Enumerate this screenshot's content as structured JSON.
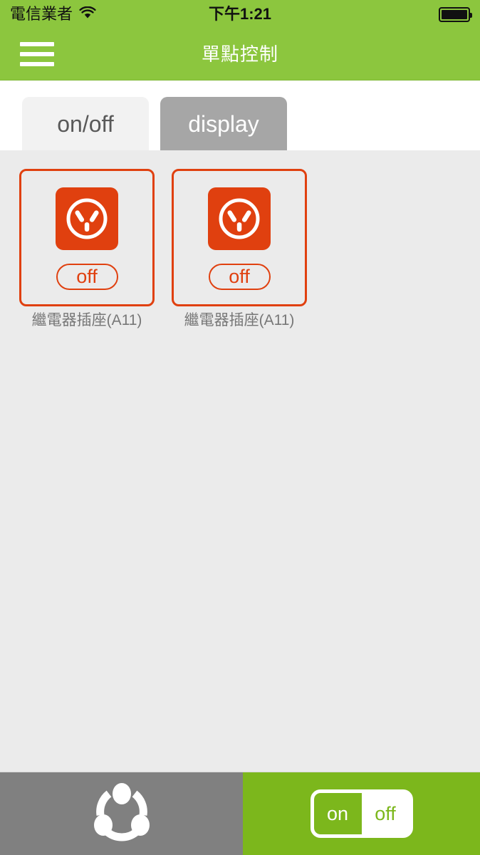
{
  "status_bar": {
    "carrier": "電信業者",
    "wifi_icon": "wifi-icon",
    "time": "下午1:21",
    "battery_icon": "battery-full-icon"
  },
  "nav_bar": {
    "menu_icon": "hamburger-menu-icon",
    "title": "單點控制"
  },
  "tabs": [
    {
      "label": "on/off",
      "active": true
    },
    {
      "label": "display",
      "active": false
    }
  ],
  "devices": [
    {
      "icon": "power-socket-icon",
      "state_label": "off",
      "name": "繼電器插座(A11)"
    },
    {
      "icon": "power-socket-icon",
      "state_label": "off",
      "name": "繼電器插座(A11)"
    }
  ],
  "bottom_bar": {
    "scene_icon": "scene-group-icon",
    "toggle": {
      "on_label": "on",
      "off_label": "off",
      "selected": "off"
    }
  },
  "colors": {
    "brand_green": "#8cc63e",
    "bar_green": "#7cb71c",
    "accent_orange": "#e0400f",
    "content_bg": "#ebebeb",
    "tab_active_bg": "#f2f2f2",
    "tab_inactive_bg": "#a6a6a6",
    "bottom_gray": "#808080"
  }
}
